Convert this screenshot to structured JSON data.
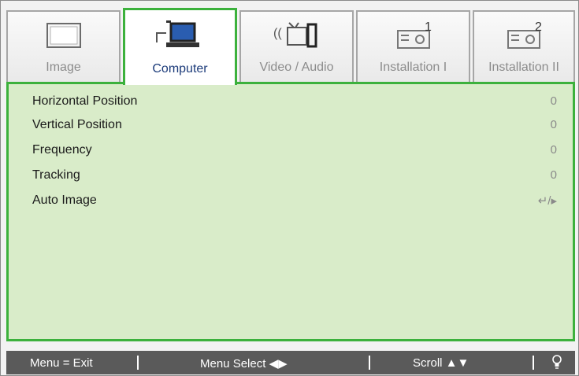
{
  "tabs": [
    {
      "label": "Image",
      "icon": "monitor-icon",
      "active": false
    },
    {
      "label": "Computer",
      "icon": "computer-icon",
      "active": true
    },
    {
      "label": "Video / Audio",
      "icon": "video-audio-icon",
      "active": false
    },
    {
      "label": "Installation I",
      "icon": "projector-icon",
      "active": false
    },
    {
      "label": "Installation II",
      "icon": "projector-2-icon",
      "active": false
    }
  ],
  "menu": {
    "items": [
      {
        "label": "Horizontal Position",
        "value": "0"
      },
      {
        "label": "Vertical Position",
        "value": "0"
      },
      {
        "label": "Frequency",
        "value": "0"
      },
      {
        "label": "Tracking",
        "value": "0"
      },
      {
        "label": "Auto Image",
        "value": "↵/▸",
        "icon": "enter-arrow-icon"
      }
    ]
  },
  "footer": {
    "exit": "Menu = Exit",
    "select": "Menu Select ◀▶",
    "scroll": "Scroll ▲▼",
    "icon": "lightbulb-icon"
  },
  "colors": {
    "accent": "#3cb13c",
    "panel": "#d9ecc9",
    "active_label": "#1c3b7a",
    "footer": "#5a5a5a"
  }
}
